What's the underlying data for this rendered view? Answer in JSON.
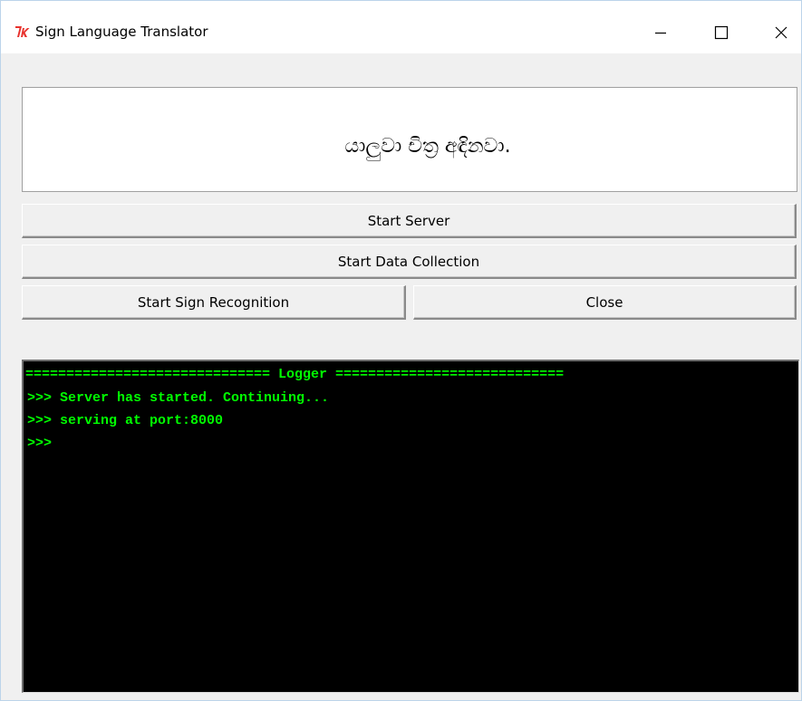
{
  "window": {
    "title": "Sign Language Translator",
    "icon": "tk-feather-icon",
    "controls": {
      "minimize": "minimize-icon",
      "maximize": "maximize-icon",
      "close": "close-icon"
    }
  },
  "message": {
    "text": "යාලුවා චිත්‍ර අඳිනවා."
  },
  "buttons": {
    "start_server": "Start Server",
    "start_data_collection": "Start Data Collection",
    "start_sign_recognition": "Start Sign Recognition",
    "close": "Close"
  },
  "logger": {
    "header": "============================== Logger ============================",
    "lines": [
      ">>> Server has started. Continuing...",
      ">>> serving at port:8000",
      ">>>"
    ]
  },
  "colors": {
    "logger_background": "#000000",
    "logger_text": "#00ff00",
    "window_background": "#f0f0f0",
    "icon_accent": "#e8322d"
  }
}
